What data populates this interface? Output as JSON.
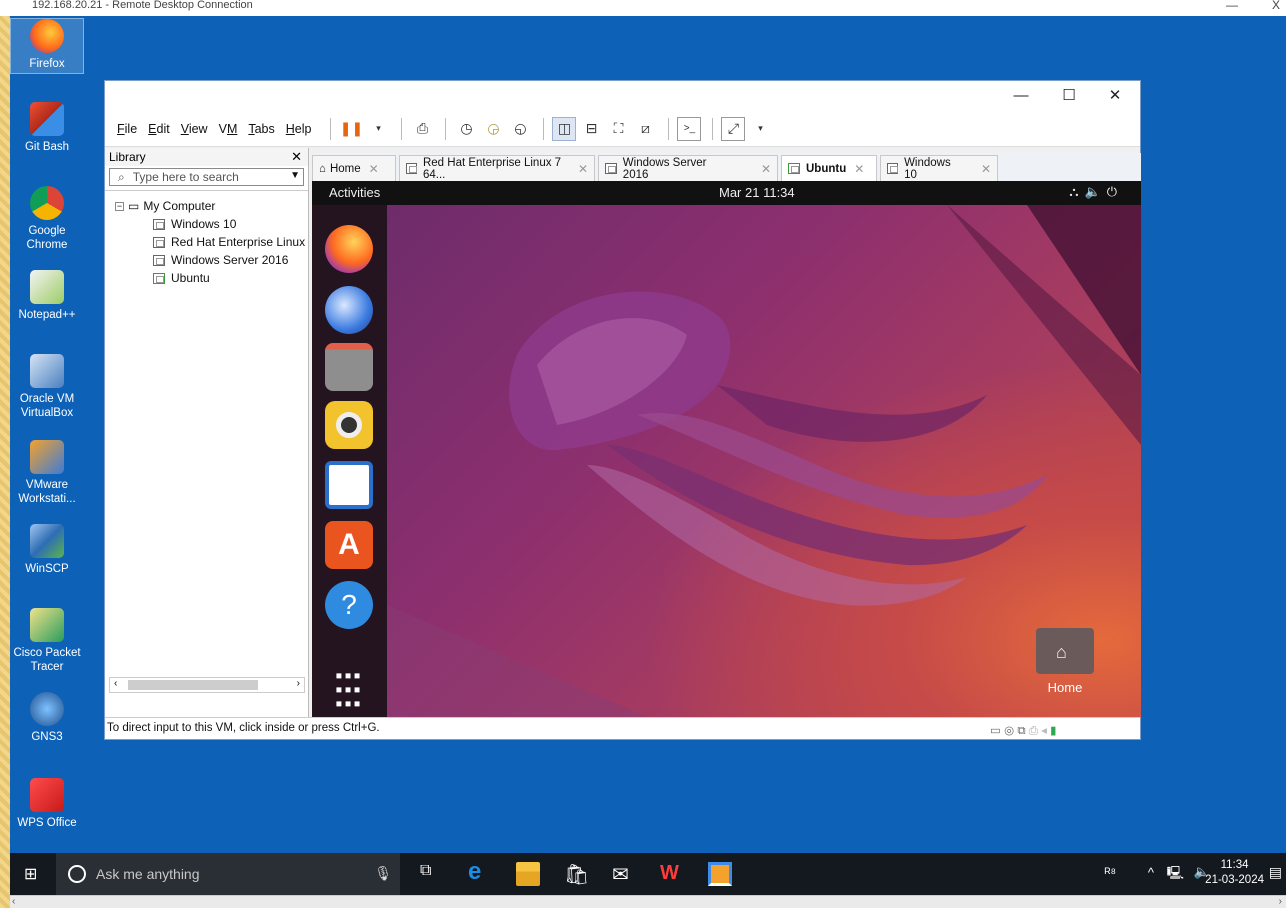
{
  "rdp": {
    "title": "192.168.20.21 - Remote Desktop Connection",
    "min": "—",
    "close": "X"
  },
  "desktop": {
    "icons": [
      {
        "label": "Firefox"
      },
      {
        "label": "Git Bash"
      },
      {
        "label": "Google Chrome"
      },
      {
        "label": "Notepad++"
      },
      {
        "label": "Oracle VM VirtualBox"
      },
      {
        "label": "VMware Workstati..."
      },
      {
        "label": "WinSCP"
      },
      {
        "label": "Cisco Packet Tracer"
      },
      {
        "label": "GNS3"
      },
      {
        "label": "WPS Office"
      }
    ]
  },
  "vmware": {
    "menu": [
      {
        "label": "File",
        "mn": "F"
      },
      {
        "label": "Edit",
        "mn": "E"
      },
      {
        "label": "View",
        "mn": "V"
      },
      {
        "label": "VM",
        "mn": "M"
      },
      {
        "label": "Tabs",
        "mn": "T"
      },
      {
        "label": "Help",
        "mn": "H"
      }
    ],
    "library": {
      "title": "Library",
      "search_placeholder": "Type here to search",
      "root": "My Computer",
      "vms": [
        "Windows 10",
        "Red Hat Enterprise Linux",
        "Windows Server 2016",
        "Ubuntu"
      ]
    },
    "tabs": [
      {
        "label": "Home"
      },
      {
        "label": "Red Hat Enterprise Linux 7 64..."
      },
      {
        "label": "Windows Server 2016"
      },
      {
        "label": "Ubuntu",
        "active": true
      },
      {
        "label": "Windows 10"
      }
    ],
    "status": "To direct input to this VM, click inside or press Ctrl+G."
  },
  "ubuntu": {
    "activities": "Activities",
    "clock": "Mar 21  11:34",
    "home_label": "Home"
  },
  "taskbar": {
    "search_placeholder": "Ask me anything",
    "time": "11:34",
    "date": "21-03-2024"
  },
  "colors": {
    "desktop": "#0d62b8",
    "taskbar": "#14191f",
    "ubuntu_accent": "#e95420"
  }
}
